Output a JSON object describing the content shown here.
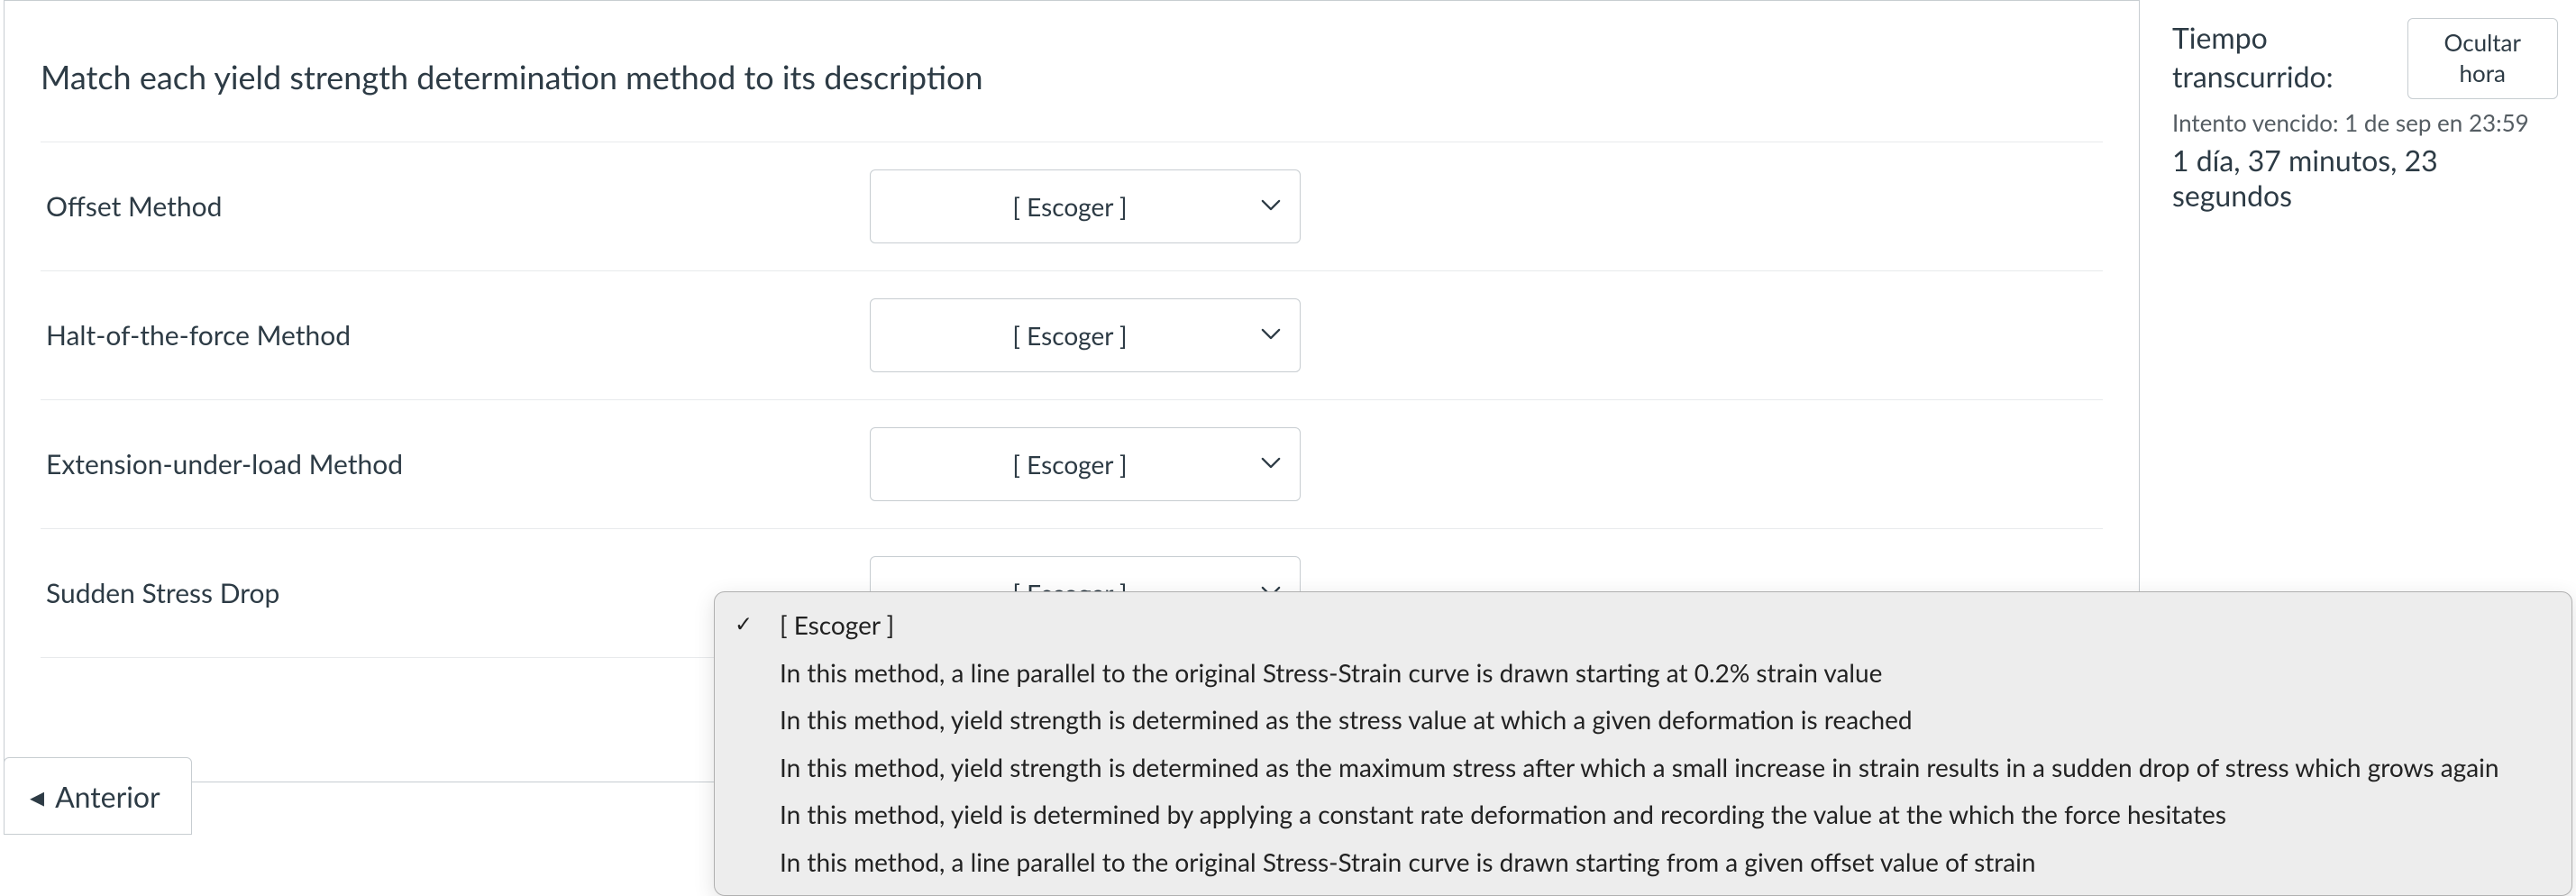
{
  "question": {
    "prompt": "Match each yield strength determination method to its description",
    "rows": [
      {
        "label": "Offset Method",
        "value": "[ Escoger ]"
      },
      {
        "label": "Halt-of-the-force Method",
        "value": "[ Escoger ]"
      },
      {
        "label": "Extension-under-load Method",
        "value": "[ Escoger ]"
      },
      {
        "label": "Sudden Stress Drop",
        "value": "[ Escoger ]"
      }
    ],
    "select_placeholder": "[ Escoger ]"
  },
  "dropdown": {
    "options": [
      "[ Escoger ]",
      "In this method, a line parallel to the original Stress-Strain curve is drawn starting at 0.2% strain value",
      "In this method, yield strength is determined as the stress value at which a given deformation is reached",
      "In this method, yield strength is determined as the maximum stress after which a small increase in strain results in a sudden drop of stress which grows again",
      "In this method, yield is determined by applying a constant rate deformation and recording the value at the which the force hesitates",
      "In this method, a line parallel to the original Stress-Strain curve is drawn starting from a given offset value of strain"
    ],
    "selected_index": 0
  },
  "sidebar": {
    "time_label": "Tiempo transcurrido:",
    "hide_button": "Ocultar hora",
    "attempt_due": "Intento vencido: 1 de sep en 23:59",
    "time_remaining": "1 día, 37 minutos, 23 segundos"
  },
  "nav": {
    "prev": "Anterior",
    "prev_arrow": "◂"
  }
}
